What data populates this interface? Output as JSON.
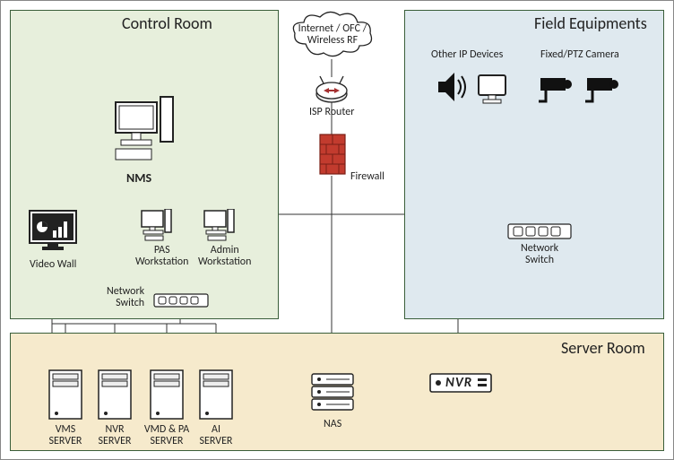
{
  "zones": {
    "control_room": {
      "title": "Control Room"
    },
    "field": {
      "title": "Field Equipments"
    },
    "server_room": {
      "title": "Server Room"
    }
  },
  "nodes": {
    "nms": {
      "label": "NMS"
    },
    "video_wall": {
      "label": "Video Wall"
    },
    "pas_ws": {
      "label": "PAS\nWorkstation"
    },
    "admin_ws": {
      "label": "Admin\nWorkstation"
    },
    "net_switch_ctrl": {
      "label": "Network\nSwitch"
    },
    "internet": {
      "label": "Internet / OFC /\nWireless RF"
    },
    "isp_router": {
      "label": "ISP Router"
    },
    "firewall": {
      "label": "Firewall"
    },
    "other_ip": {
      "label": "Other IP Devices"
    },
    "ptz_camera": {
      "label": "Fixed/PTZ Camera"
    },
    "net_switch_fld": {
      "label": "Network\nSwitch"
    },
    "vms_server": {
      "label": "VMS\nSERVER"
    },
    "nvr_server": {
      "label": "NVR\nSERVER"
    },
    "vmd_pa_server": {
      "label": "VMD & PA\nSERVER"
    },
    "ai_server": {
      "label": "AI\nSERVER"
    },
    "nas": {
      "label": "NAS"
    },
    "nvr": {
      "label": "NVR"
    }
  }
}
